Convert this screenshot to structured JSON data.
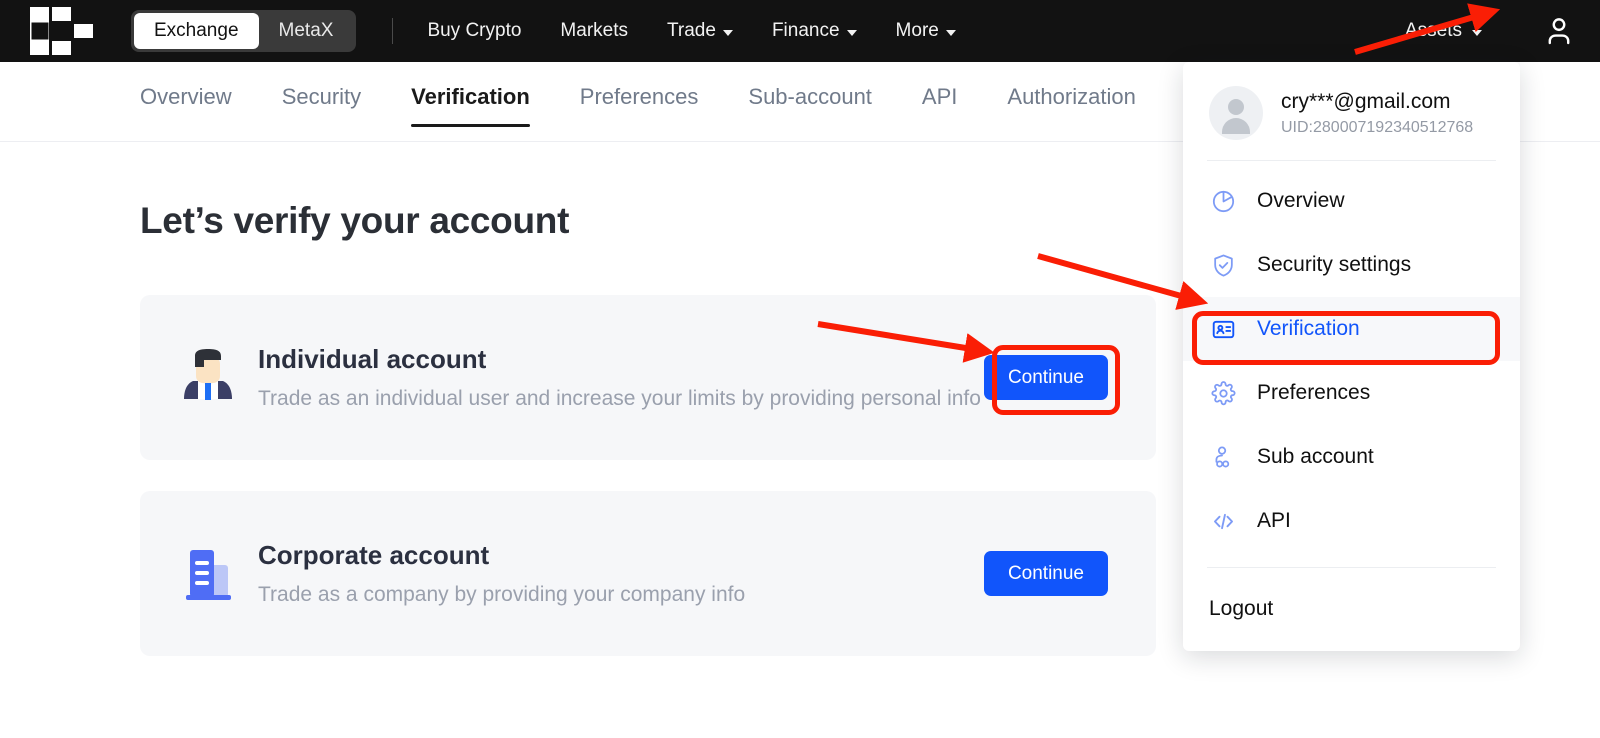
{
  "topnav": {
    "logo_name": "okx-logo",
    "segmented": {
      "options": [
        "Exchange",
        "MetaX"
      ],
      "selected": "Exchange"
    },
    "links": [
      {
        "label": "Buy Crypto",
        "caret": false
      },
      {
        "label": "Markets",
        "caret": false
      },
      {
        "label": "Trade",
        "caret": true
      },
      {
        "label": "Finance",
        "caret": true
      },
      {
        "label": "More",
        "caret": true
      }
    ],
    "assets_label": "Assets",
    "user_icon": "user-avatar-icon"
  },
  "subnav": {
    "tabs": [
      {
        "label": "Overview",
        "active": false
      },
      {
        "label": "Security",
        "active": false
      },
      {
        "label": "Verification",
        "active": true
      },
      {
        "label": "Preferences",
        "active": false
      },
      {
        "label": "Sub-account",
        "active": false
      },
      {
        "label": "API",
        "active": false
      },
      {
        "label": "Authorization",
        "active": false
      }
    ]
  },
  "main": {
    "page_title": "Let’s verify your account",
    "cards": [
      {
        "icon": "individual-person-icon",
        "title": "Individual account",
        "description": "Trade as an individual user and increase your limits by providing personal info",
        "button_label": "Continue"
      },
      {
        "icon": "corporate-building-icon",
        "title": "Corporate account",
        "description": "Trade as a company by providing your company info",
        "button_label": "Continue"
      }
    ]
  },
  "dropdown": {
    "account": {
      "email": "cry***@gmail.com",
      "uid": "UID:280007192340512768",
      "avatar": "profile-avatar"
    },
    "items": [
      {
        "label": "Overview",
        "icon": "pie-chart-icon",
        "selected": false
      },
      {
        "label": "Security settings",
        "icon": "shield-check-icon",
        "selected": false
      },
      {
        "label": "Verification",
        "icon": "id-card-icon",
        "selected": true
      },
      {
        "label": "Preferences",
        "icon": "gear-icon",
        "selected": false
      },
      {
        "label": "Sub account",
        "icon": "sub-account-icon",
        "selected": false
      },
      {
        "label": "API",
        "icon": "code-brackets-icon",
        "selected": false
      }
    ],
    "logout_label": "Logout"
  },
  "annotations": {
    "color": "#FA1E05",
    "highlight_boxes": [
      "continue-button-individual",
      "verification-menu-item"
    ],
    "arrows": [
      "arrow-to-user-icon",
      "arrow-to-verification-item",
      "arrow-to-continue-button"
    ]
  },
  "colors": {
    "accent_blue": "#1155FB",
    "topbar_bg": "#121212",
    "card_bg": "#F6F7F9",
    "annotation_red": "#FA1E05"
  }
}
